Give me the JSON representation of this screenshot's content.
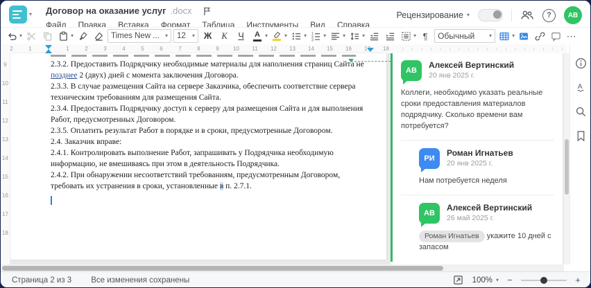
{
  "header": {
    "doc_title": "Договор на оказание услуг",
    "doc_ext": ".docx",
    "menu_items": [
      "Файл",
      "Правка",
      "Вставка",
      "Формат",
      "Таблица",
      "Инструменты",
      "Вид",
      "Справка"
    ],
    "review_label": "Рецензирование",
    "avatar_initials": "АВ"
  },
  "toolbar": {
    "font_name": "Times New ...",
    "font_size": "12",
    "bold_label": "Ж",
    "italic_label": "К",
    "underline_label": "Ч",
    "font_color_label": "А",
    "style_name": "Обычный"
  },
  "icons": {
    "caret": "▾",
    "pilcrow": "¶",
    "more": "⋯",
    "minus": "−",
    "plus": "+"
  },
  "ruler": {
    "h_numbers": [
      "2",
      "1",
      "",
      "1",
      "2",
      "3",
      "4",
      "5",
      "6",
      "7",
      "8",
      "9",
      "10",
      "11",
      "12",
      "13",
      "14",
      "15",
      "16",
      "17",
      "18"
    ],
    "v_numbers": [
      "9",
      "10",
      "11",
      "12",
      "13",
      "14",
      "15",
      "16",
      "17",
      "18"
    ]
  },
  "document": {
    "p232_before": "2.3.2. Предоставить Подрядчику необходимые материалы для наполнения страниц Сайта не ",
    "p232_marked": "позднее",
    "p232_after": " 2 (двух) дней с момента заключения Договора.",
    "p233": "2.3.3. В случае размещения Сайта на сервере Заказчика, обеспечить соответствие сервера техническим требованиям для размещения Сайта.",
    "p234": "2.3.4. Предоставить Подрядчику доступ к серверу для размещения Сайта и для выполнения Работ, предусмотренных Договором.",
    "p235": "2.3.5. Оплатить результат Работ в порядке и в сроки, предусмотренные Договором.",
    "p24": "2.4. Заказчик вправе:",
    "p241": "2.4.1. Контролировать выполнение Работ, запрашивать у Подрядчика необходимую информацию, не вмешиваясь при этом в деятельность Подрядчика.",
    "p242_before": "2.4.2. При обнаружении несоответствий требованиям, предусмотренным Договором, требовать их устранения в сроки, установленные ",
    "p242_marked": "в",
    "p242_after": " п. 2.7.1."
  },
  "comments": [
    {
      "initials": "АВ",
      "color": "#2fc464",
      "name": "Алексей Вертинский",
      "date": "20 янв 2025 г.",
      "text": "Коллеги, необходимо указать реальные сроки предоставления материалов подрядчику. Сколько времени вам потребуется?"
    },
    {
      "initials": "РИ",
      "color": "#3d8af0",
      "name": "Роман Игнатьев",
      "date": "20 янв 2025 г.",
      "text": "Нам потребуется неделя"
    },
    {
      "initials": "АВ",
      "color": "#2fc464",
      "name": "Алексей Вертинский",
      "date": "26 май 2025 г.",
      "mention": "Роман Игнатьев",
      "text": "укажите 10 дней с запасом"
    }
  ],
  "status_bar": {
    "page_info": "Страница 2 из 3",
    "save_status": "Все изменения сохранены",
    "zoom_level": "100%"
  },
  "colors": {
    "accent_teal": "#3fc0cf",
    "comment_green": "#2fc464",
    "reply_blue": "#3d8af0",
    "marker_blue": "#2d9fd8"
  }
}
